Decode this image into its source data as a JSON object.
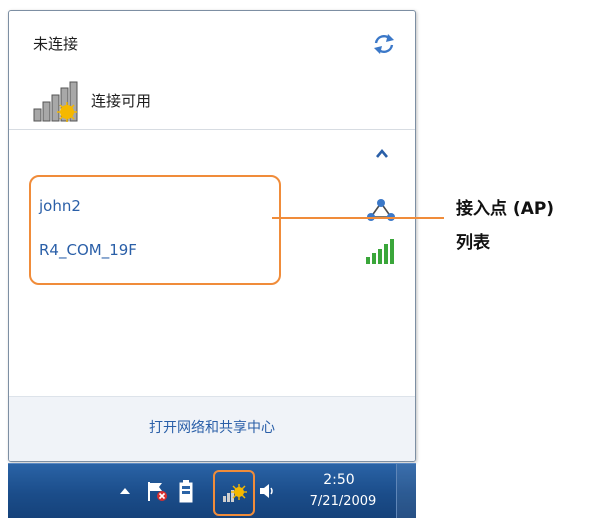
{
  "flyout": {
    "status_title": "未连接",
    "connection_label": "连接可用",
    "networks": [
      {
        "name": "john2",
        "icon": "adhoc-network-icon"
      },
      {
        "name": "R4_COM_19F",
        "icon": "wifi-signal-icon"
      }
    ],
    "open_center_link": "打开网络和共享中心"
  },
  "taskbar": {
    "time": "2:50",
    "date": "7/21/2009"
  },
  "callout": {
    "line1": "接入点 (AP)",
    "line2": "列表"
  },
  "colors": {
    "highlight": "#f08c3a",
    "link": "#2a5fa8",
    "signal_green": "#3aa63a",
    "taskbar": "#1b4d8a"
  }
}
